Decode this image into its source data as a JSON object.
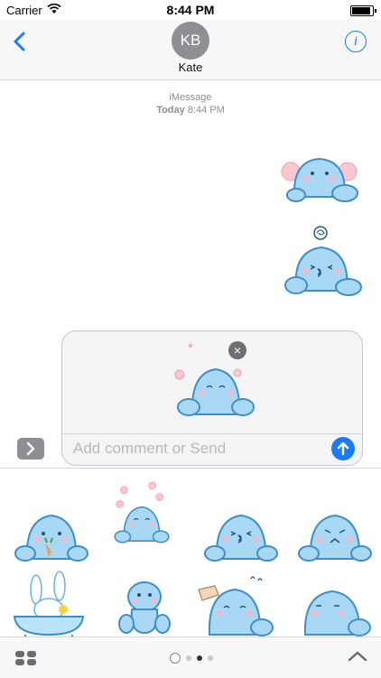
{
  "status_bar": {
    "carrier": "Carrier",
    "time": "8:44 PM"
  },
  "header": {
    "avatar_initials": "KB",
    "contact_name": "Kate",
    "info_glyph": "i"
  },
  "conversation": {
    "service": "iMessage",
    "day": "Today",
    "time": "8:44 PM"
  },
  "compose": {
    "placeholder": "Add comment or Send",
    "close_glyph": "×"
  },
  "colors": {
    "accent": "#1a7cf5",
    "sticker_body": "#a9d8f5",
    "sticker_outline": "#3f8fc5",
    "cheek": "#f7b7c4"
  },
  "tray": {
    "rows": [
      [
        "seal-carrot",
        "seal-flowers",
        "seal-pout",
        "seal-grumpy"
      ],
      [
        "bunny-bath",
        "seal-front",
        "seal-petted",
        "seal-sleepy"
      ]
    ]
  },
  "bottom_bar": {
    "icons": [
      "app-drawer-icon",
      "recents-icon",
      "chevron-up-icon"
    ]
  }
}
